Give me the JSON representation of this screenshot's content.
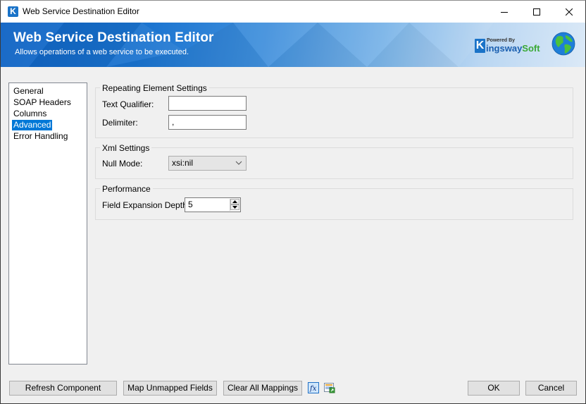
{
  "window": {
    "title": "Web Service Destination Editor",
    "icon": "kingswaysoft-k-icon",
    "controls": [
      "minimize",
      "maximize",
      "close"
    ]
  },
  "banner": {
    "title": "Web Service Destination Editor",
    "subtitle": "Allows operations of a web service to be executed.",
    "logo_powered_by": "Powered By",
    "logo_kingsway": "ingsway",
    "logo_k": "K",
    "logo_soft": "Soft",
    "globe_icon": "globe-icon"
  },
  "nav": {
    "items": [
      {
        "label": "General",
        "selected": false
      },
      {
        "label": "SOAP Headers",
        "selected": false
      },
      {
        "label": "Columns",
        "selected": false
      },
      {
        "label": "Advanced",
        "selected": true
      },
      {
        "label": "Error Handling",
        "selected": false
      }
    ]
  },
  "repeating": {
    "group_label": "Repeating Element Settings",
    "text_qualifier_label": "Text Qualifier:",
    "text_qualifier_value": "",
    "delimiter_label": "Delimiter:",
    "delimiter_value": ","
  },
  "xml": {
    "group_label": "Xml Settings",
    "null_mode_label": "Null Mode:",
    "null_mode_value": "xsi:nil"
  },
  "performance": {
    "group_label": "Performance",
    "field_depth_label": "Field Expansion Depth:",
    "field_depth_value": "5"
  },
  "footer": {
    "refresh_label": "Refresh Component",
    "map_unmapped_label": "Map Unmapped Fields",
    "clear_mappings_label": "Clear All Mappings",
    "ok_label": "OK",
    "cancel_label": "Cancel",
    "icons": [
      "expression-fx-icon",
      "mapping-export-icon"
    ]
  },
  "colors": {
    "selection": "#0078d7",
    "banner_dark": "#0e63c4",
    "banner_light": "#dbe9f7",
    "brand_blue": "#1a73c8",
    "brand_green": "#3aa935"
  }
}
